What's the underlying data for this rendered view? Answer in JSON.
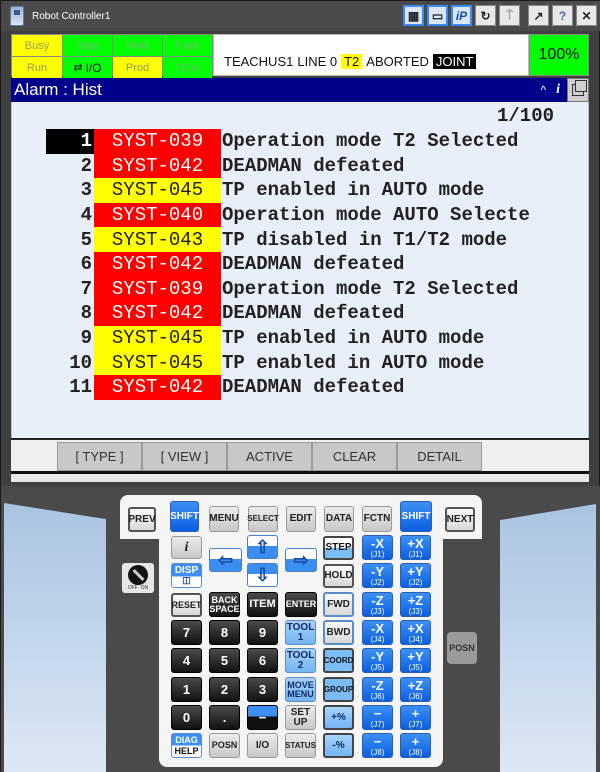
{
  "window": {
    "title": "Robot Controller1",
    "toolbar_icons": [
      {
        "name": "controller-icon",
        "glyph": "▦",
        "active": true
      },
      {
        "name": "keyboard-icon",
        "glyph": "▭",
        "active": true
      },
      {
        "name": "ip-icon",
        "glyph": "iP",
        "active": true
      },
      {
        "name": "refresh-icon",
        "glyph": "↻",
        "active": false
      },
      {
        "name": "robot-icon",
        "glyph": "⍑",
        "active": false,
        "dim": true
      },
      {
        "name": "export-icon",
        "glyph": "↗",
        "active": false
      },
      {
        "name": "help-icon",
        "glyph": "?",
        "active": false
      },
      {
        "name": "close-icon",
        "glyph": "✕",
        "active": false
      }
    ]
  },
  "status": {
    "lamps": [
      {
        "label": "Busy",
        "color": "yellow"
      },
      {
        "label": "Step",
        "color": "green"
      },
      {
        "label": "Hold",
        "color": "green"
      },
      {
        "label": "Fault",
        "color": "green"
      },
      {
        "label": "Run",
        "color": "yellow"
      },
      {
        "label": "I/O",
        "color": "green",
        "icon": "io-icon"
      },
      {
        "label": "Prod",
        "color": "yellow"
      },
      {
        "label": "TCyc",
        "color": "green"
      }
    ],
    "program": "TEACHUS1",
    "line": "LINE 0",
    "mode": "T2",
    "state": "ABORTED",
    "coord": "JOINT",
    "override": "100%"
  },
  "screen": {
    "title": "Alarm : Hist",
    "caret": "^",
    "info": "i",
    "page": "1/100"
  },
  "alarms": [
    {
      "num": "1",
      "code": "SYST-039",
      "severity": "red",
      "message": "Operation mode T2 Selected",
      "selected": true
    },
    {
      "num": "2",
      "code": "SYST-042",
      "severity": "red",
      "message": "DEADMAN defeated"
    },
    {
      "num": "3",
      "code": "SYST-045",
      "severity": "yellow",
      "message": "TP enabled in AUTO mode"
    },
    {
      "num": "4",
      "code": "SYST-040",
      "severity": "red",
      "message": "Operation mode AUTO Selecte"
    },
    {
      "num": "5",
      "code": "SYST-043",
      "severity": "yellow",
      "message": "TP disabled in T1/T2 mode"
    },
    {
      "num": "6",
      "code": "SYST-042",
      "severity": "red",
      "message": "DEADMAN defeated"
    },
    {
      "num": "7",
      "code": "SYST-039",
      "severity": "red",
      "message": "Operation mode T2 Selected"
    },
    {
      "num": "8",
      "code": "SYST-042",
      "severity": "red",
      "message": "DEADMAN defeated"
    },
    {
      "num": "9",
      "code": "SYST-045",
      "severity": "yellow",
      "message": "TP enabled in AUTO mode"
    },
    {
      "num": "10",
      "code": "SYST-045",
      "severity": "yellow",
      "message": "TP enabled in AUTO mode"
    },
    {
      "num": "11",
      "code": "SYST-042",
      "severity": "red",
      "message": "DEADMAN defeated"
    }
  ],
  "function_keys": [
    "[ TYPE ]",
    "[ VIEW ]",
    "ACTIVE",
    "CLEAR",
    "DETAIL"
  ],
  "keypad": {
    "prev": "PREV",
    "next": "NEXT",
    "shift": "SHIFT",
    "menu": "MENU",
    "select": "SELECT",
    "edit": "EDIT",
    "data": "DATA",
    "fctn": "FCTN",
    "info_glyph": "i",
    "disp": "DISP",
    "step": "STEP",
    "hold": "HOLD",
    "fwd": "FWD",
    "bwd": "BWD",
    "reset": "RESET",
    "backspace_1": "BACK",
    "backspace_2": "SPACE",
    "item": "ITEM",
    "enter": "ENTER",
    "tool1_1": "TOOL",
    "tool1_2": "1",
    "tool2_1": "TOOL",
    "tool2_2": "2",
    "coord": "COORD",
    "group": "GROUP",
    "move_menu_1": "MOVE",
    "move_menu_2": "MENU",
    "setup_1": "SET",
    "setup_2": "UP",
    "plus_pct": "+%",
    "minus_pct": "-%",
    "diag": "DIAG",
    "help": "HELP",
    "posn": "POSN",
    "io": "I/O",
    "status": "STATUS",
    "posn_side": "POSN",
    "switch_off": "OFF",
    "switch_on": "ON",
    "digits": [
      "7",
      "8",
      "9",
      "4",
      "5",
      "6",
      "1",
      "2",
      "3",
      "0",
      "."
    ],
    "minus_comma": "−",
    "jog": [
      {
        "axis": "-X",
        "joint": "(J1)"
      },
      {
        "axis": "+X",
        "joint": "(J1)"
      },
      {
        "axis": "-Y",
        "joint": "(J2)"
      },
      {
        "axis": "+Y",
        "joint": "(J2)"
      },
      {
        "axis": "-Z",
        "joint": "(J3)"
      },
      {
        "axis": "+Z",
        "joint": "(J3)"
      },
      {
        "axis": "-X",
        "joint": "(J4)"
      },
      {
        "axis": "+X",
        "joint": "(J4)"
      },
      {
        "axis": "-Y",
        "joint": "(J5)"
      },
      {
        "axis": "+Y",
        "joint": "(J5)"
      },
      {
        "axis": "-Z",
        "joint": "(J6)"
      },
      {
        "axis": "+Z",
        "joint": "(J6)"
      },
      {
        "axis": "−",
        "joint": "(J7)"
      },
      {
        "axis": "+",
        "joint": "(J7)"
      },
      {
        "axis": "−",
        "joint": "(J8)"
      },
      {
        "axis": "+",
        "joint": "(J8)"
      }
    ]
  }
}
